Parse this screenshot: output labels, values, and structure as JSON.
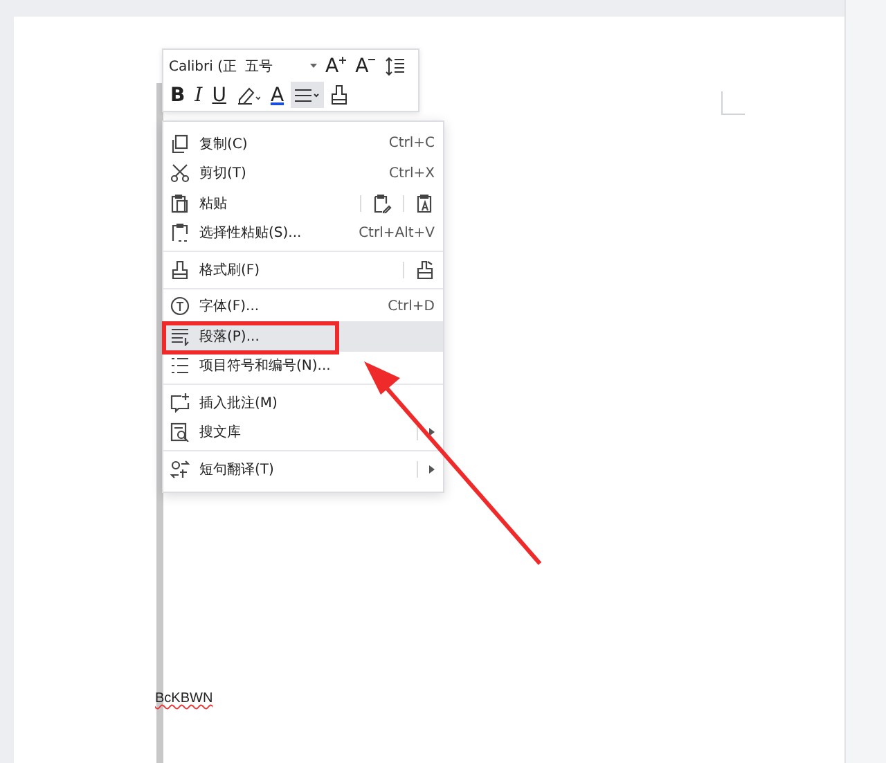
{
  "toolbar": {
    "font": "Calibri (正",
    "size": "五号",
    "grow_font": "A",
    "shrink_font": "A",
    "bold": "B",
    "italic": "I",
    "underline": "U",
    "font_color": "A",
    "align_pressed": true
  },
  "menu": {
    "groups": [
      [
        {
          "label": "复制(C)",
          "shortcut": "Ctrl+C",
          "selected": false
        },
        {
          "label": "剪切(T)",
          "shortcut": "Ctrl+X",
          "selected": false
        },
        {
          "label": "粘贴",
          "selected": false,
          "kind": "paste"
        },
        {
          "label": "选择性粘贴(S)...",
          "shortcut": "Ctrl+Alt+V",
          "selected": false
        }
      ],
      [
        {
          "label": "格式刷(F)",
          "selected": false,
          "kind": "brush"
        }
      ],
      [
        {
          "label": "字体(F)...",
          "shortcut": "Ctrl+D",
          "selected": false
        },
        {
          "label": "段落(P)...",
          "selected": true
        },
        {
          "label": "项目符号和编号(N)...",
          "selected": false
        }
      ],
      [
        {
          "label": "插入批注(M)",
          "selected": false
        },
        {
          "label": "搜文库",
          "selected": false,
          "kind": "submenu"
        }
      ],
      [
        {
          "label": "短句翻译(T)",
          "selected": false,
          "kind": "submenu"
        }
      ]
    ]
  },
  "document": {
    "text": "BcKBWN"
  }
}
